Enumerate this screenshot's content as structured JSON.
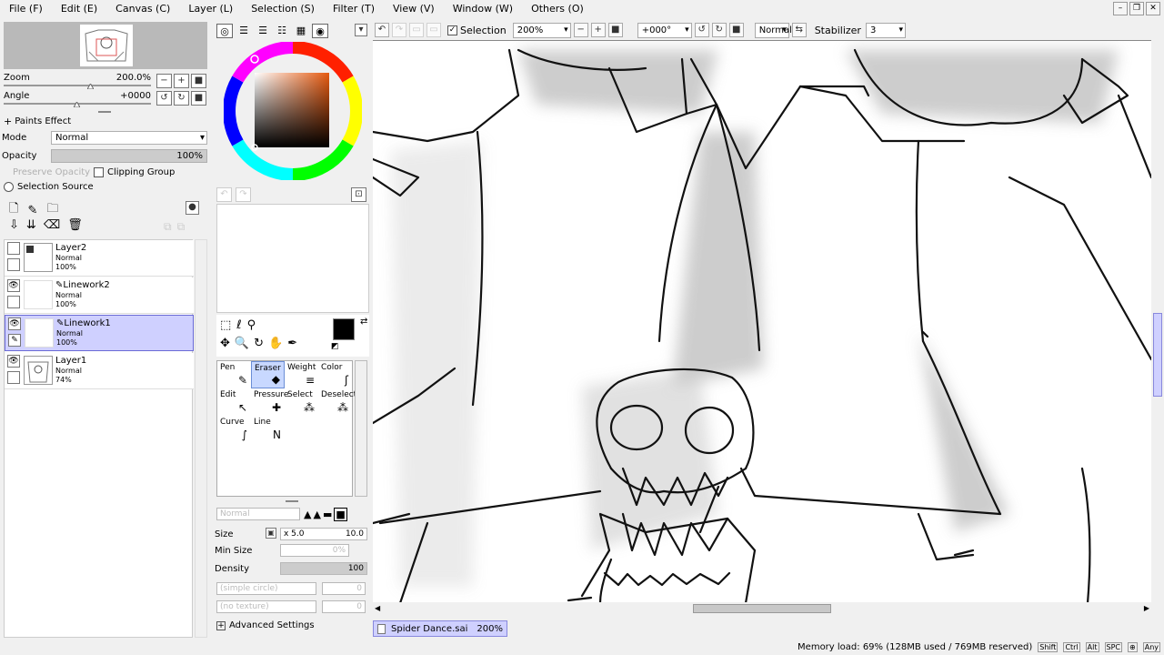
{
  "menu": [
    "File (F)",
    "Edit (E)",
    "Canvas (C)",
    "Layer (L)",
    "Selection (S)",
    "Filter (T)",
    "View (V)",
    "Window (W)",
    "Others (O)"
  ],
  "toolbar": {
    "selection_label": "Selection",
    "zoom_value": "200%",
    "angle_value": "+000°",
    "mode_value": "Normal",
    "stabilizer_label": "Stabilizer",
    "stabilizer_value": "3"
  },
  "navigator": {
    "zoom_label": "Zoom",
    "zoom_value": "200.0%",
    "angle_label": "Angle",
    "angle_value": "+0000"
  },
  "layer_props": {
    "paints_effect": "Paints Effect",
    "mode_label": "Mode",
    "mode_value": "Normal",
    "opacity_label": "Opacity",
    "opacity_value": "100%",
    "preserve_opacity": "Preserve Opacity",
    "clipping_group": "Clipping Group",
    "selection_source": "Selection Source"
  },
  "layers": [
    {
      "name": "Layer2",
      "mode": "Normal",
      "opacity": "100%",
      "visible": false,
      "selected": false
    },
    {
      "name": "Linework2",
      "mode": "Normal",
      "opacity": "100%",
      "visible": true,
      "selected": false
    },
    {
      "name": "Linework1",
      "mode": "Normal",
      "opacity": "100%",
      "visible": true,
      "selected": true
    },
    {
      "name": "Layer1",
      "mode": "Normal",
      "opacity": "74%",
      "visible": true,
      "selected": false
    }
  ],
  "tools": [
    {
      "label": "Pen",
      "glyph": "✎"
    },
    {
      "label": "Eraser",
      "glyph": "◆"
    },
    {
      "label": "Weight",
      "glyph": "≡"
    },
    {
      "label": "Color",
      "glyph": "ʃ"
    },
    {
      "label": "Edit",
      "glyph": "↖"
    },
    {
      "label": "Pressure",
      "glyph": "✚"
    },
    {
      "label": "Select",
      "glyph": "⁂"
    },
    {
      "label": "Deselect",
      "glyph": "⁂"
    },
    {
      "label": "Curve",
      "glyph": "∫"
    },
    {
      "label": "Line",
      "glyph": "N"
    }
  ],
  "brush": {
    "blend_mode": "Normal",
    "size_label": "Size",
    "size_mult": "x 5.0",
    "size_value": "10.0",
    "min_size_label": "Min Size",
    "min_size_value": "0%",
    "density_label": "Density",
    "density_value": "100",
    "shape": "(simple circle)",
    "shape_value": "0",
    "texture": "(no texture)",
    "texture_value": "0",
    "advanced": "Advanced Settings"
  },
  "document": {
    "name": "Spider Dance.sai",
    "zoom": "200%"
  },
  "status": {
    "memory": "Memory load: 69% (128MB used / 769MB reserved)",
    "keys": [
      "Shift",
      "Ctrl",
      "Alt",
      "SPC",
      "⊕",
      "Any"
    ]
  },
  "colors": {
    "accent": "#cfd0ff",
    "primary_color": "#000000",
    "secondary_color": "#ffffff"
  }
}
